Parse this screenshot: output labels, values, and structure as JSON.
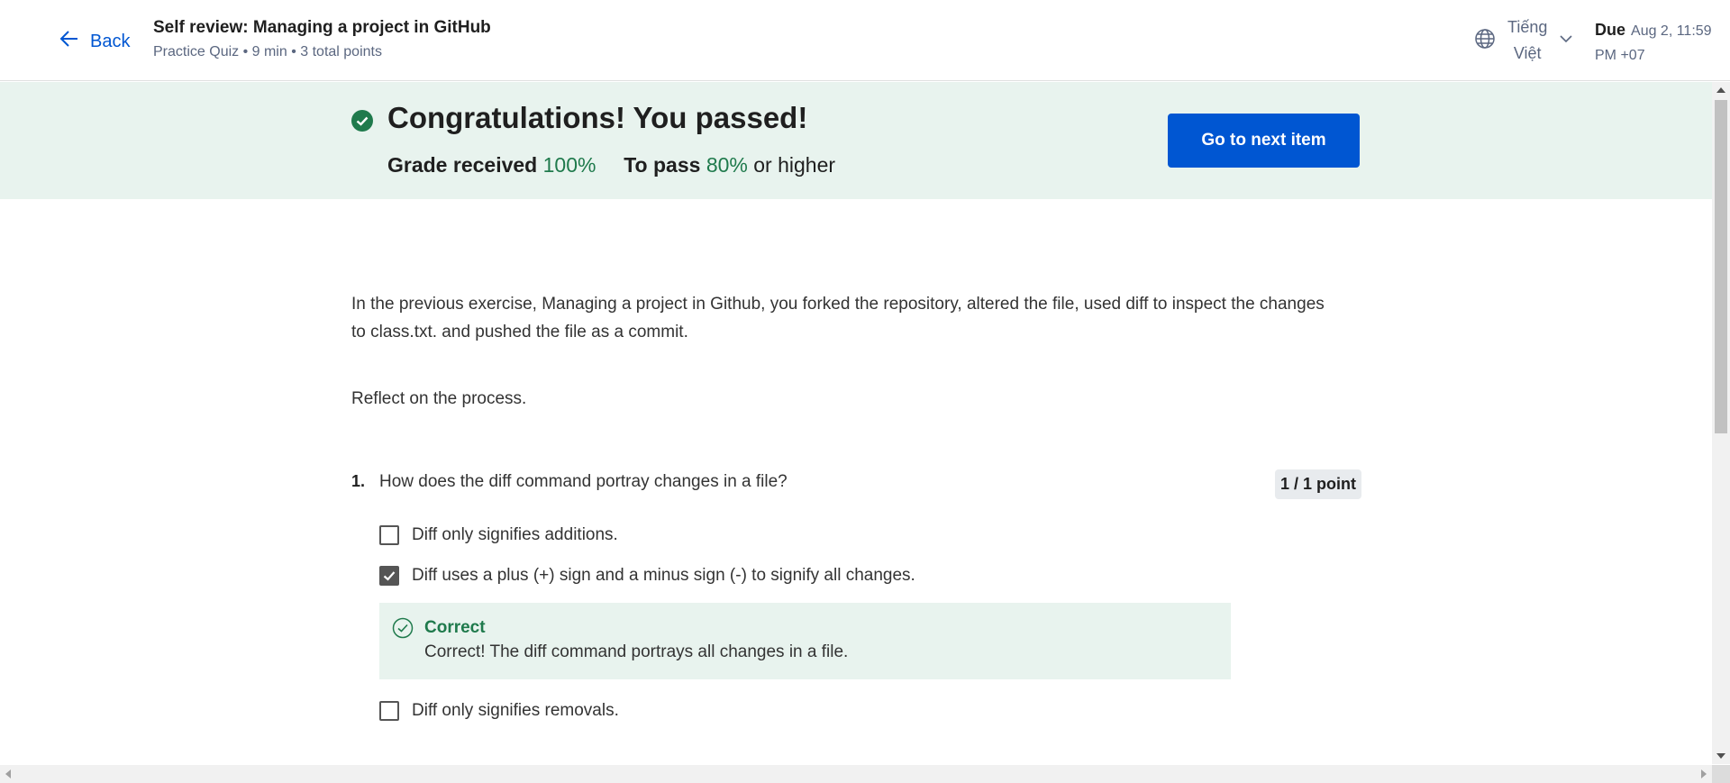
{
  "header": {
    "back_label": "Back",
    "title": "Self review: Managing a project in GitHub",
    "subtitle": "Practice Quiz • 9 min • 3 total points",
    "language_line1": "Tiếng",
    "language_line2": "Việt",
    "due_label": "Due",
    "due_line1": "Aug 2, 11:59",
    "due_line2": "PM +07"
  },
  "banner": {
    "title": "Congratulations! You passed!",
    "grade_label": "Grade received",
    "grade_value": "100%",
    "pass_label": "To pass",
    "pass_value": "80%",
    "pass_suffix": "or higher",
    "next_button": "Go to next item"
  },
  "content": {
    "intro": "In the previous exercise, Managing a project in Github, you forked the repository, altered the file, used diff to inspect the changes to class.txt. and pushed the file as a commit.",
    "reflect": "Reflect on the process."
  },
  "question": {
    "number": "1.",
    "text": "How does the diff command portray changes in a file?",
    "points": "1 / 1 point",
    "options": [
      {
        "label": "Diff only signifies additions.",
        "checked": false
      },
      {
        "label": "Diff uses a plus (+) sign and a minus sign (-) to signify all changes.",
        "checked": true
      },
      {
        "label": "Diff only signifies removals.",
        "checked": false
      }
    ],
    "feedback_title": "Correct",
    "feedback_text": "Correct! The diff command portrays all changes in a file."
  },
  "colors": {
    "accent": "#0056d2",
    "success": "#1f7a4c",
    "banner_bg": "#e8f3ee"
  }
}
